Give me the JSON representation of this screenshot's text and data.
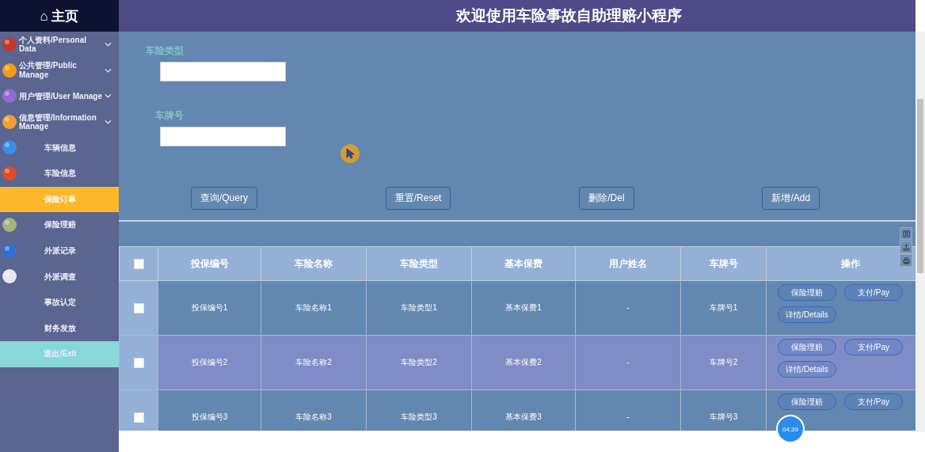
{
  "sidebar": {
    "home": "⌂ 主页",
    "items": [
      {
        "label": "个人资料/Personal Data",
        "kind": "group",
        "icon": true,
        "selected": false
      },
      {
        "label": "公共管理/Public Manage",
        "kind": "group",
        "icon": true,
        "selected": false
      },
      {
        "label": "用户管理/User Manage",
        "kind": "group",
        "icon": true,
        "selected": false
      },
      {
        "label": "信息管理/Information Manage",
        "kind": "group",
        "icon": true,
        "selected": false
      },
      {
        "label": "车辆信息",
        "kind": "item",
        "icon": true,
        "selected": false
      },
      {
        "label": "车险信息",
        "kind": "item",
        "icon": true,
        "selected": false
      },
      {
        "label": "保险订单",
        "kind": "item",
        "icon": false,
        "selected": true
      },
      {
        "label": "保险理赔",
        "kind": "item",
        "icon": true,
        "selected": false
      },
      {
        "label": "外派记录",
        "kind": "item",
        "icon": true,
        "selected": false
      },
      {
        "label": "外派调查",
        "kind": "item",
        "icon": true,
        "selected": false
      },
      {
        "label": "事故认定",
        "kind": "item",
        "icon": false,
        "selected": false
      },
      {
        "label": "财务发放",
        "kind": "item",
        "icon": false,
        "selected": false
      },
      {
        "label": "退出/Exit",
        "kind": "exit",
        "icon": false,
        "selected": false
      }
    ]
  },
  "header": {
    "title": "欢迎使用车险事故自助理赔小程序"
  },
  "search": {
    "fields": [
      {
        "label": "车险类型"
      },
      {
        "label": "车牌号"
      }
    ],
    "buttons": [
      "查询/Query",
      "重置/Reset",
      "删除/Del",
      "新增/Add"
    ]
  },
  "table": {
    "select_all": {
      "checked": false
    },
    "columns": [
      "投保编号",
      "车险名称",
      "车险类型",
      "基本保费",
      "用户姓名",
      "车牌号",
      "操作"
    ],
    "rows": [
      {
        "cells": [
          "投保编号1",
          "车险名称1",
          "车险类型1",
          "基本保费1",
          "-",
          "车牌号1"
        ],
        "checked": false,
        "selected": false,
        "actions": [
          "保险理赔",
          "支付/Pay",
          "详情/Details"
        ]
      },
      {
        "cells": [
          "投保编号2",
          "车险名称2",
          "车险类型2",
          "基本保费2",
          "-",
          "车牌号2"
        ],
        "checked": false,
        "selected": true,
        "actions": [
          "保险理赔",
          "支付/Pay",
          "详情/Details"
        ]
      },
      {
        "cells": [
          "投保编号3",
          "车险名称3",
          "车险类型3",
          "基本保费3",
          "-",
          "车牌号3"
        ],
        "checked": false,
        "selected": false,
        "actions": [
          "保险理赔",
          "支付/Pay"
        ]
      }
    ]
  },
  "timer": "04:39"
}
